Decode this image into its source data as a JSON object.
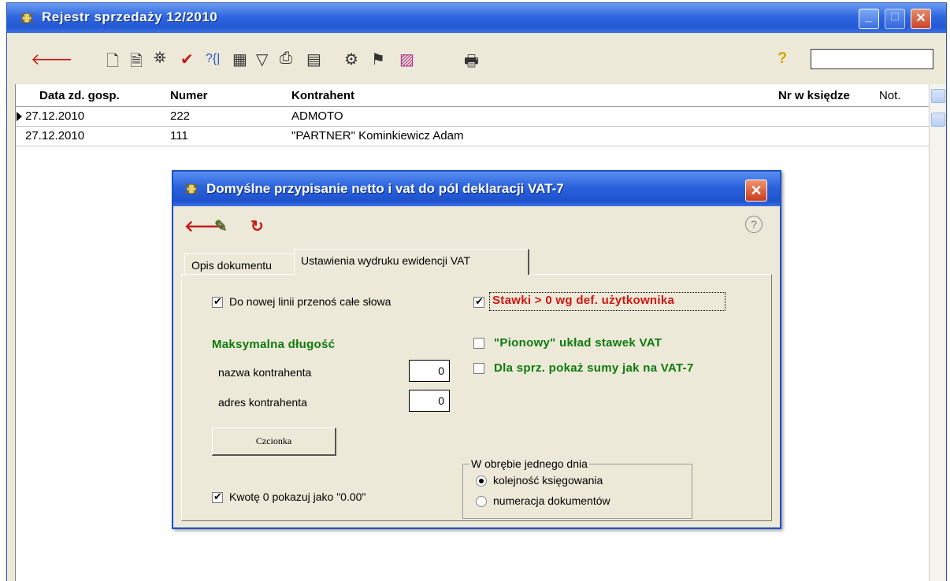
{
  "main_window": {
    "title": "Rejestr sprzedaży 12/2010",
    "search_value": ""
  },
  "toolbar": {
    "icons": [
      "back-arrow-icon",
      "new-document-icon",
      "copy-document-icon",
      "binoculars-icon",
      "checkmark-icon",
      "help-bracket-icon",
      "table-icon",
      "filter-icon",
      "print-icon",
      "calculator-icon",
      "group-icon",
      "users-icon",
      "chart-icon",
      "printer-icon",
      "help-icon"
    ]
  },
  "grid": {
    "columns": [
      "Data zd. gosp.",
      "Numer",
      "Kontrahent",
      "Nr w księdze",
      "Not."
    ],
    "rows": [
      {
        "date": "27.12.2010",
        "number": "222",
        "contractor": "ADMOTO",
        "ledger_no": "",
        "note": ""
      },
      {
        "date": "27.12.2010",
        "number": "111",
        "contractor": "\"PARTNER\" Kominkiewicz Adam",
        "ledger_no": "",
        "note": ""
      }
    ]
  },
  "dialog": {
    "title": "Domyślne przypisanie netto i vat do pól deklaracji VAT-7",
    "tabs": [
      "Opis dokumentu",
      "Ustawienia wydruku ewidencji VAT"
    ],
    "active_tab": "Ustawienia wydruku ewidencji VAT",
    "checkbox_wrap_words": {
      "label": "Do nowej linii przenoś całe słowa",
      "checked": true
    },
    "max_length_heading": "Maksymalna długość",
    "contractor_name": {
      "label": "nazwa kontrahenta",
      "value": "0"
    },
    "contractor_address": {
      "label": "adres kontrahenta",
      "value": "0"
    },
    "font_button": "Czcionka",
    "checkbox_zero_amount": {
      "label": "Kwotę 0  pokazuj  jako  \"0.00\"",
      "checked": true
    },
    "checkbox_rates_user": {
      "label": "Stawki > 0 wg def. użytkownika",
      "checked": true
    },
    "checkbox_vertical_rates": {
      "label": "\"Pionowy\" układ stawek VAT",
      "checked": false
    },
    "checkbox_sales_sums": {
      "label": "Dla sprz. pokaż sumy  jak na VAT-7",
      "checked": false
    },
    "same_day_group": {
      "title": "W obrębie jednego dnia",
      "options": [
        "kolejność księgowania",
        "numeracja dokumentów"
      ],
      "selected": "kolejność księgowania"
    }
  },
  "colors": {
    "titlebar": "#2458d3",
    "green_label": "#0d7a0d",
    "red_label": "#d01515",
    "window_bg": "#ece9d8"
  }
}
